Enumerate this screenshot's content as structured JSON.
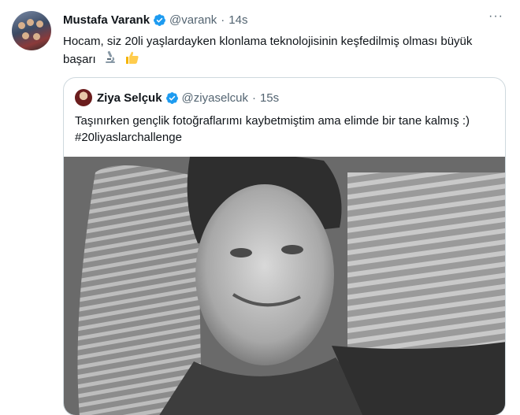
{
  "tweet": {
    "author_name": "Mustafa Varank",
    "handle": "@varank",
    "separator": "·",
    "time": "14s",
    "text": "Hocam, siz 20li yaşlardayken klonlama teknolojisinin keşfedilmiş olması büyük başarı",
    "emojis": [
      "microscope",
      "thumbs-up"
    ],
    "more_label": "···"
  },
  "quote": {
    "author_name": "Ziya Selçuk",
    "handle": "@ziyaselcuk",
    "separator": "·",
    "time": "15s",
    "text": "Taşınırken gençlik fotoğraflarımı kaybetmiştim ama elimde bir tane kalmış :) #20liyaslarchallenge"
  },
  "colors": {
    "verified": "#1d9bf0",
    "secondary_text": "#536471",
    "border": "#cfd9de"
  }
}
